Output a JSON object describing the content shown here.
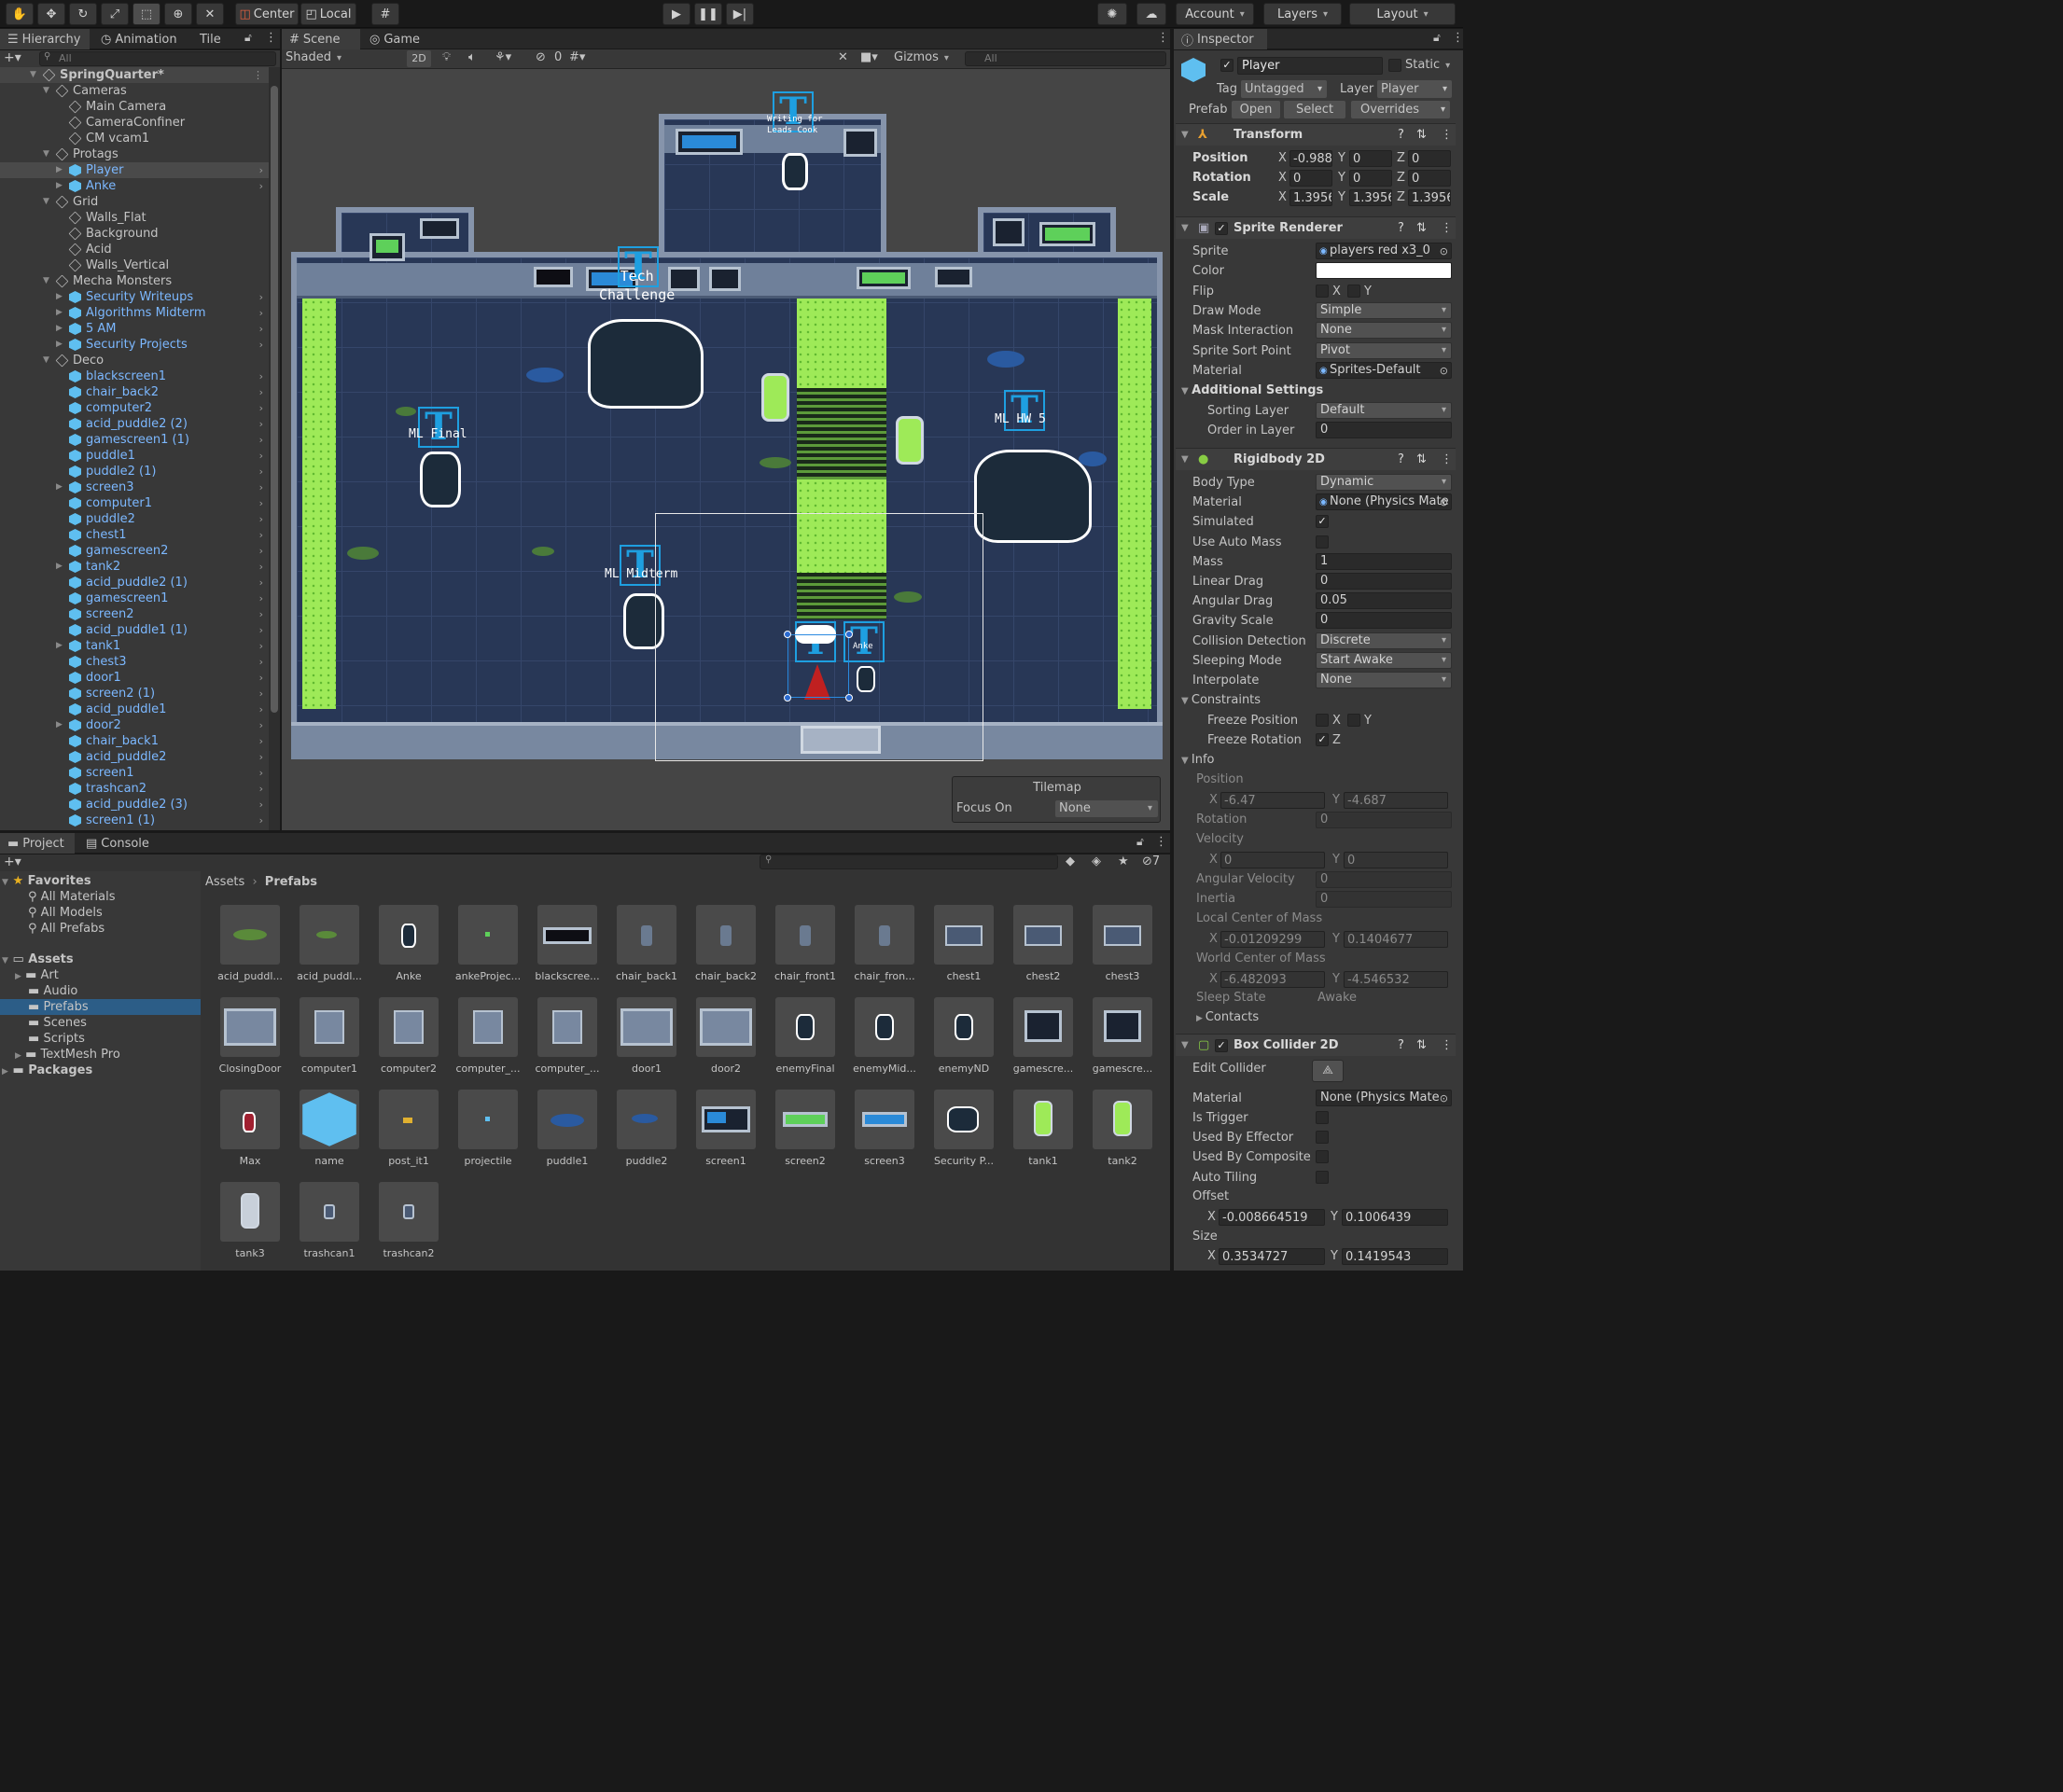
{
  "toolbar": {
    "pivot_label": "Center",
    "space_label": "Local",
    "account_label": "Account",
    "layers_label": "Layers",
    "layout_label": "Layout"
  },
  "hierarchy": {
    "tabs": [
      "Hierarchy",
      "Animation",
      "Tile"
    ],
    "search_placeholder": "All",
    "rows": [
      {
        "label": "SpringQuarter*",
        "depth": 0,
        "kind": "scene",
        "expanded": true
      },
      {
        "label": "Cameras",
        "depth": 1,
        "kind": "go",
        "expanded": true
      },
      {
        "label": "Main Camera",
        "depth": 2,
        "kind": "go"
      },
      {
        "label": "CameraConfiner",
        "depth": 2,
        "kind": "go"
      },
      {
        "label": "CM vcam1",
        "depth": 2,
        "kind": "go"
      },
      {
        "label": "Protags",
        "depth": 1,
        "kind": "go",
        "expanded": true
      },
      {
        "label": "Player",
        "depth": 2,
        "kind": "prefab",
        "collapsed": true,
        "selected": true
      },
      {
        "label": "Anke",
        "depth": 2,
        "kind": "prefab",
        "collapsed": true
      },
      {
        "label": "Grid",
        "depth": 1,
        "kind": "go",
        "expanded": true
      },
      {
        "label": "Walls_Flat",
        "depth": 2,
        "kind": "go"
      },
      {
        "label": "Background",
        "depth": 2,
        "kind": "go"
      },
      {
        "label": "Acid",
        "depth": 2,
        "kind": "go"
      },
      {
        "label": "Walls_Vertical",
        "depth": 2,
        "kind": "go"
      },
      {
        "label": "Mecha Monsters",
        "depth": 1,
        "kind": "go",
        "expanded": true
      },
      {
        "label": "Security Writeups",
        "depth": 2,
        "kind": "prefab",
        "collapsed": true
      },
      {
        "label": "Algorithms Midterm",
        "depth": 2,
        "kind": "prefab",
        "collapsed": true
      },
      {
        "label": "5 AM",
        "depth": 2,
        "kind": "prefab",
        "collapsed": true
      },
      {
        "label": "Security Projects",
        "depth": 2,
        "kind": "prefab",
        "collapsed": true
      },
      {
        "label": "Deco",
        "depth": 1,
        "kind": "go",
        "expanded": true
      },
      {
        "label": "blackscreen1",
        "depth": 2,
        "kind": "prefab"
      },
      {
        "label": "chair_back2",
        "depth": 2,
        "kind": "prefab"
      },
      {
        "label": "computer2",
        "depth": 2,
        "kind": "prefab"
      },
      {
        "label": "acid_puddle2 (2)",
        "depth": 2,
        "kind": "prefab"
      },
      {
        "label": "gamescreen1 (1)",
        "depth": 2,
        "kind": "prefab"
      },
      {
        "label": "puddle1",
        "depth": 2,
        "kind": "prefab"
      },
      {
        "label": "puddle2 (1)",
        "depth": 2,
        "kind": "prefab"
      },
      {
        "label": "screen3",
        "depth": 2,
        "kind": "prefab",
        "collapsed": true
      },
      {
        "label": "computer1",
        "depth": 2,
        "kind": "prefab"
      },
      {
        "label": "puddle2",
        "depth": 2,
        "kind": "prefab"
      },
      {
        "label": "chest1",
        "depth": 2,
        "kind": "prefab"
      },
      {
        "label": "gamescreen2",
        "depth": 2,
        "kind": "prefab"
      },
      {
        "label": "tank2",
        "depth": 2,
        "kind": "prefab",
        "collapsed": true
      },
      {
        "label": "acid_puddle2 (1)",
        "depth": 2,
        "kind": "prefab"
      },
      {
        "label": "gamescreen1",
        "depth": 2,
        "kind": "prefab"
      },
      {
        "label": "screen2",
        "depth": 2,
        "kind": "prefab"
      },
      {
        "label": "acid_puddle1 (1)",
        "depth": 2,
        "kind": "prefab"
      },
      {
        "label": "tank1",
        "depth": 2,
        "kind": "prefab",
        "collapsed": true
      },
      {
        "label": "chest3",
        "depth": 2,
        "kind": "prefab"
      },
      {
        "label": "door1",
        "depth": 2,
        "kind": "prefab"
      },
      {
        "label": "screen2 (1)",
        "depth": 2,
        "kind": "prefab"
      },
      {
        "label": "acid_puddle1",
        "depth": 2,
        "kind": "prefab"
      },
      {
        "label": "door2",
        "depth": 2,
        "kind": "prefab",
        "collapsed": true
      },
      {
        "label": "chair_back1",
        "depth": 2,
        "kind": "prefab"
      },
      {
        "label": "acid_puddle2",
        "depth": 2,
        "kind": "prefab"
      },
      {
        "label": "screen1",
        "depth": 2,
        "kind": "prefab"
      },
      {
        "label": "trashcan2",
        "depth": 2,
        "kind": "prefab"
      },
      {
        "label": "acid_puddle2 (3)",
        "depth": 2,
        "kind": "prefab"
      },
      {
        "label": "screen1 (1)",
        "depth": 2,
        "kind": "prefab"
      }
    ]
  },
  "scene": {
    "tabs": [
      "Scene",
      "Game"
    ],
    "shading_mode": "Shaded",
    "mode_2d": "2D",
    "hidden_count": "0",
    "gizmos_label": "Gizmos",
    "search_placeholder": "All",
    "labels": {
      "tech_challenge": "Tech\nChallenge",
      "ml_final": "ML Final",
      "ml_midterm": "ML Midterm",
      "ml_hw5": "ML HW 5",
      "writing": "Writing for\nLeads Cook",
      "anke_tag": "Anke"
    },
    "tilemap": {
      "title": "Tilemap",
      "focus_label": "Focus On",
      "focus_value": "None"
    }
  },
  "inspector": {
    "tab": "Inspector",
    "object_name": "Player",
    "static_label": "Static",
    "tag_label": "Tag",
    "tag_value": "Untagged",
    "layer_label": "Layer",
    "layer_value": "Player",
    "prefab_label": "Prefab",
    "prefab_buttons": [
      "Open",
      "Select",
      "Overrides"
    ],
    "transform": {
      "title": "Transform",
      "position": {
        "label": "Position",
        "x": "-0.988",
        "y": "0",
        "z": "0"
      },
      "rotation": {
        "label": "Rotation",
        "x": "0",
        "y": "0",
        "z": "0"
      },
      "scale": {
        "label": "Scale",
        "x": "1.3956",
        "y": "1.3956",
        "z": "1.3956"
      }
    },
    "sprite_renderer": {
      "title": "Sprite Renderer",
      "rows": [
        {
          "label": "Sprite",
          "value": "players red x3_0",
          "kind": "object"
        },
        {
          "label": "Color",
          "value": "",
          "kind": "color"
        },
        {
          "label": "Flip",
          "value": "X  Y",
          "kind": "flip"
        },
        {
          "label": "Draw Mode",
          "value": "Simple",
          "kind": "dropdown"
        },
        {
          "label": "Mask Interaction",
          "value": "None",
          "kind": "dropdown"
        },
        {
          "label": "Sprite Sort Point",
          "value": "Pivot",
          "kind": "dropdown"
        },
        {
          "label": "Material",
          "value": "Sprites-Default",
          "kind": "object"
        }
      ],
      "additional_title": "Additional Settings",
      "sorting_layer": {
        "label": "Sorting Layer",
        "value": "Default"
      },
      "order_in_layer": {
        "label": "Order in Layer",
        "value": "0"
      }
    },
    "rigidbody": {
      "title": "Rigidbody 2D",
      "rows": [
        {
          "label": "Body Type",
          "value": "Dynamic",
          "kind": "dropdown"
        },
        {
          "label": "Material",
          "value": "None (Physics Mate",
          "kind": "object"
        },
        {
          "label": "Simulated",
          "value": "✓",
          "kind": "check"
        },
        {
          "label": "Use Auto Mass",
          "value": "",
          "kind": "check"
        },
        {
          "label": "Mass",
          "value": "1",
          "kind": "field"
        },
        {
          "label": "Linear Drag",
          "value": "0",
          "kind": "field"
        },
        {
          "label": "Angular Drag",
          "value": "0.05",
          "kind": "field"
        },
        {
          "label": "Gravity Scale",
          "value": "0",
          "kind": "field"
        },
        {
          "label": "Collision Detection",
          "value": "Discrete",
          "kind": "dropdown"
        },
        {
          "label": "Sleeping Mode",
          "value": "Start Awake",
          "kind": "dropdown"
        },
        {
          "label": "Interpolate",
          "value": "None",
          "kind": "dropdown"
        }
      ],
      "constraints_title": "Constraints",
      "freeze_position": {
        "label": "Freeze Position",
        "x": "X",
        "y": "Y"
      },
      "freeze_rotation": {
        "label": "Freeze Rotation",
        "z": "Z"
      },
      "info_title": "Info",
      "info": {
        "position_label": "Position",
        "pos_x": "-6.47",
        "pos_y": "-4.687",
        "rotation_label": "Rotation",
        "rotation_value": "0",
        "velocity_label": "Velocity",
        "vel_x": "0",
        "vel_y": "0",
        "angular_velocity_label": "Angular Velocity",
        "angular_velocity_value": "0",
        "inertia_label": "Inertia",
        "inertia_value": "0",
        "local_com_label": "Local Center of Mass",
        "lcom_x": "-0.01209299",
        "lcom_y": "0.1404677",
        "world_com_label": "World Center of Mass",
        "wcom_x": "-6.482093",
        "wcom_y": "-4.546532",
        "sleep_state_label": "Sleep State",
        "sleep_state_value": "Awake",
        "contacts_label": "Contacts"
      }
    },
    "box_collider": {
      "title": "Box Collider 2D",
      "edit_collider_label": "Edit Collider",
      "material": {
        "label": "Material",
        "value": "None (Physics Mate"
      },
      "is_trigger": "Is Trigger",
      "used_by_effector": "Used By Effector",
      "used_by_composite": "Used By Composite",
      "auto_tiling": "Auto Tiling",
      "offset_label": "Offset",
      "offset_x": "-0.008664519",
      "offset_y": "0.1006439",
      "size_label": "Size",
      "size_x": "0.3534727",
      "size_y": "0.1419543"
    }
  },
  "project": {
    "tabs": [
      "Project",
      "Console"
    ],
    "hidden_count": "7",
    "breadcrumb": [
      "Assets",
      "Prefabs"
    ],
    "favorites_label": "Favorites",
    "favorites": [
      "All Materials",
      "All Models",
      "All Prefabs"
    ],
    "assets_label": "Assets",
    "asset_folders": [
      "Art",
      "Audio",
      "Prefabs",
      "Scenes",
      "Scripts",
      "TextMesh Pro"
    ],
    "packages_label": "Packages",
    "items": [
      {
        "name": "acid_puddl...",
        "thumb": "puddle-green"
      },
      {
        "name": "acid_puddl...",
        "thumb": "puddle-green-small"
      },
      {
        "name": "Anke",
        "thumb": "character"
      },
      {
        "name": "ankeProjec...",
        "thumb": "dot-green"
      },
      {
        "name": "blackscree...",
        "thumb": "screen-black"
      },
      {
        "name": "chair_back1",
        "thumb": "chair"
      },
      {
        "name": "chair_back2",
        "thumb": "chair"
      },
      {
        "name": "chair_front1",
        "thumb": "chair"
      },
      {
        "name": "chair_fron...",
        "thumb": "chair"
      },
      {
        "name": "chest1",
        "thumb": "chest"
      },
      {
        "name": "chest2",
        "thumb": "chest"
      },
      {
        "name": "chest3",
        "thumb": "chest"
      },
      {
        "name": "ClosingDoor",
        "thumb": "door"
      },
      {
        "name": "computer1",
        "thumb": "computer"
      },
      {
        "name": "computer2",
        "thumb": "computer"
      },
      {
        "name": "computer_...",
        "thumb": "computer"
      },
      {
        "name": "computer_...",
        "thumb": "computer"
      },
      {
        "name": "door1",
        "thumb": "door"
      },
      {
        "name": "door2",
        "thumb": "door"
      },
      {
        "name": "enemyFinal",
        "thumb": "enemy"
      },
      {
        "name": "enemyMid...",
        "thumb": "enemy"
      },
      {
        "name": "enemyND",
        "thumb": "enemy"
      },
      {
        "name": "gamescre...",
        "thumb": "gamescreen"
      },
      {
        "name": "gamescre...",
        "thumb": "gamescreen"
      },
      {
        "name": "Max",
        "thumb": "character-red"
      },
      {
        "name": "name",
        "thumb": "cube"
      },
      {
        "name": "post_it1",
        "thumb": "dot-yellow"
      },
      {
        "name": "projectile",
        "thumb": "dot-blue"
      },
      {
        "name": "puddle1",
        "thumb": "puddle-blue"
      },
      {
        "name": "puddle2",
        "thumb": "puddle-blue-small"
      },
      {
        "name": "screen1",
        "thumb": "screen-multi"
      },
      {
        "name": "screen2",
        "thumb": "screen-green"
      },
      {
        "name": "screen3",
        "thumb": "screen-blue"
      },
      {
        "name": "Security P...",
        "thumb": "mech"
      },
      {
        "name": "tank1",
        "thumb": "tank-green"
      },
      {
        "name": "tank2",
        "thumb": "tank-green"
      },
      {
        "name": "tank3",
        "thumb": "tank-empty"
      },
      {
        "name": "trashcan1",
        "thumb": "trashcan"
      },
      {
        "name": "trashcan2",
        "thumb": "trashcan"
      }
    ]
  },
  "colors": {
    "accent_blue": "#1e9fe0",
    "prefab_blue": "#7cb8ff",
    "acid_green": "#9eea58",
    "panel_bg": "#383838"
  }
}
